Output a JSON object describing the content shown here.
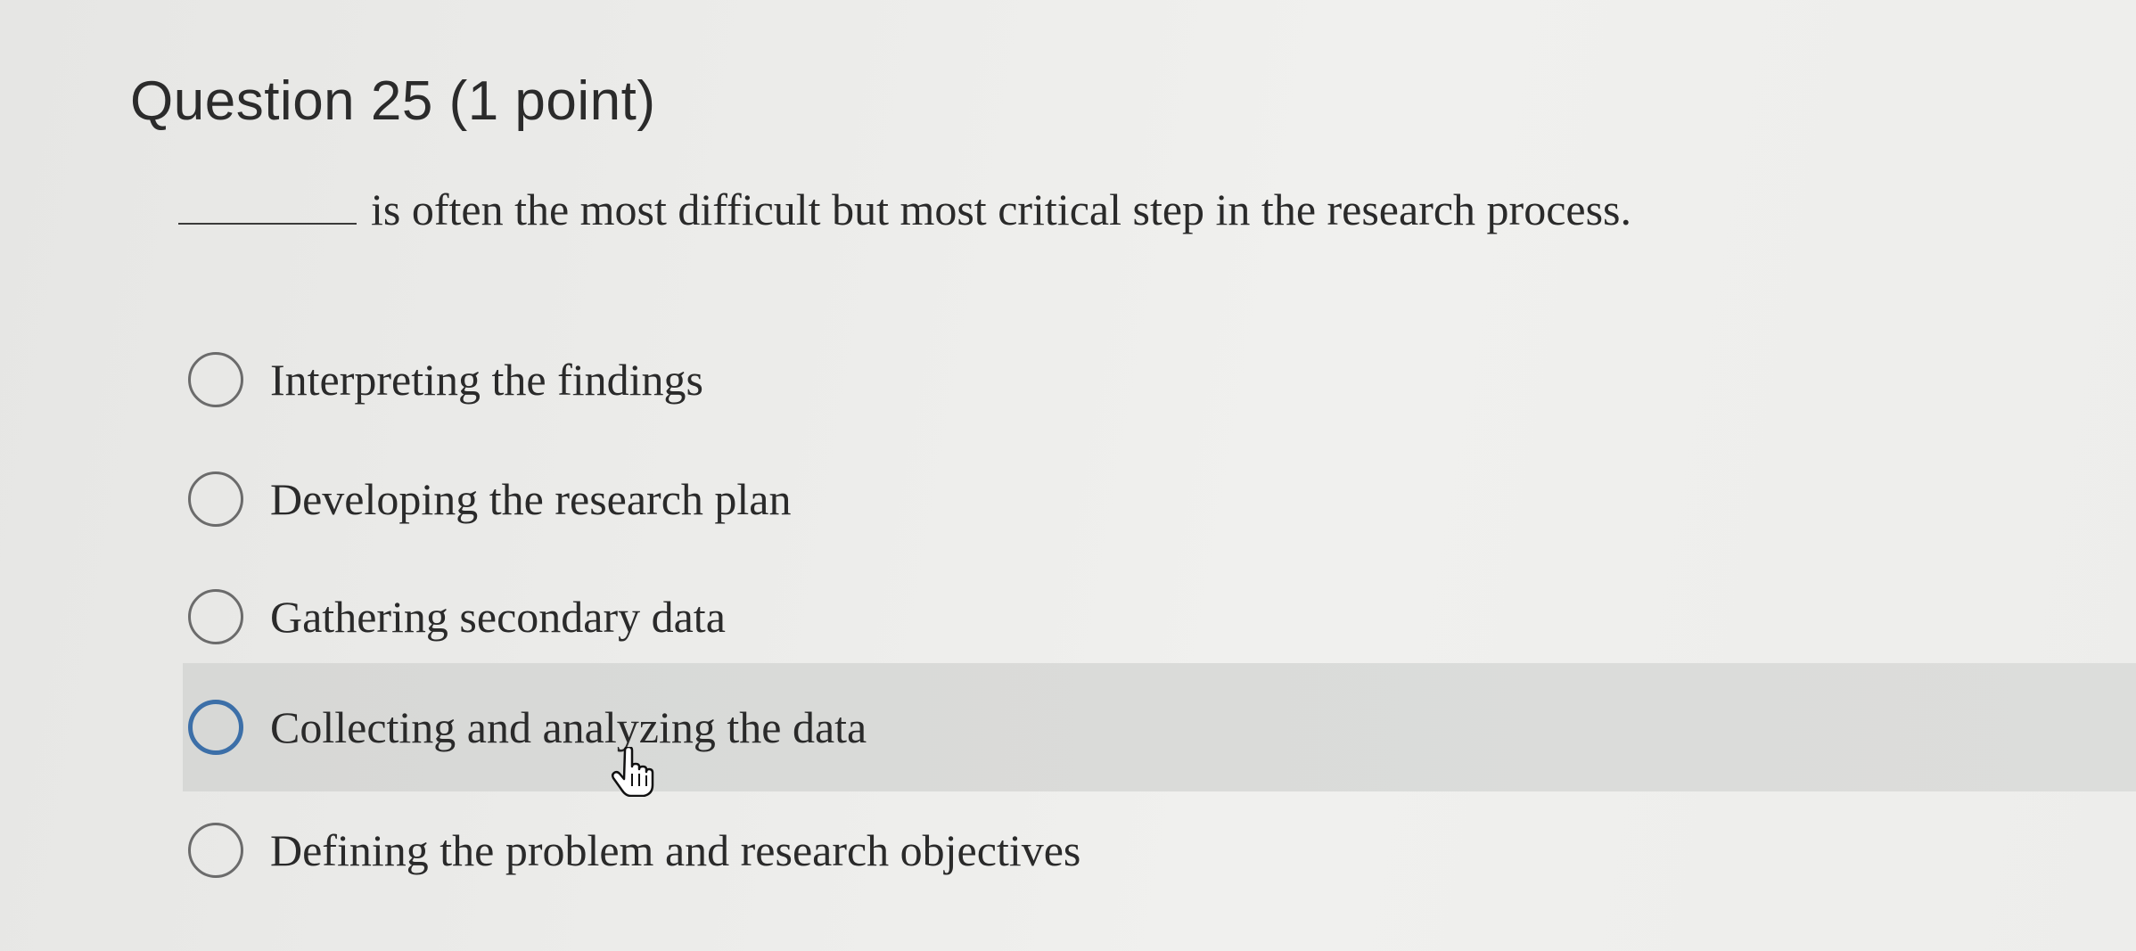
{
  "question": {
    "header": "Question 25 (1 point)",
    "prompt": "is often the most difficult but most critical step in the research process."
  },
  "options": [
    {
      "label": "Interpreting the findings",
      "selected": false,
      "hovered": false
    },
    {
      "label": "Developing the research plan",
      "selected": false,
      "hovered": false
    },
    {
      "label": "Gathering secondary data",
      "selected": false,
      "hovered": false
    },
    {
      "label": "Collecting and analyzing the data",
      "selected": false,
      "hovered": true
    },
    {
      "label": "Defining the problem and research objectives",
      "selected": false,
      "hovered": false
    }
  ],
  "cursor": {
    "icon": "hand-pointer-icon"
  },
  "colors": {
    "hover_background": "#d9dad8",
    "radio_focus": "#3c6fa8",
    "text": "#2a2a2a"
  }
}
